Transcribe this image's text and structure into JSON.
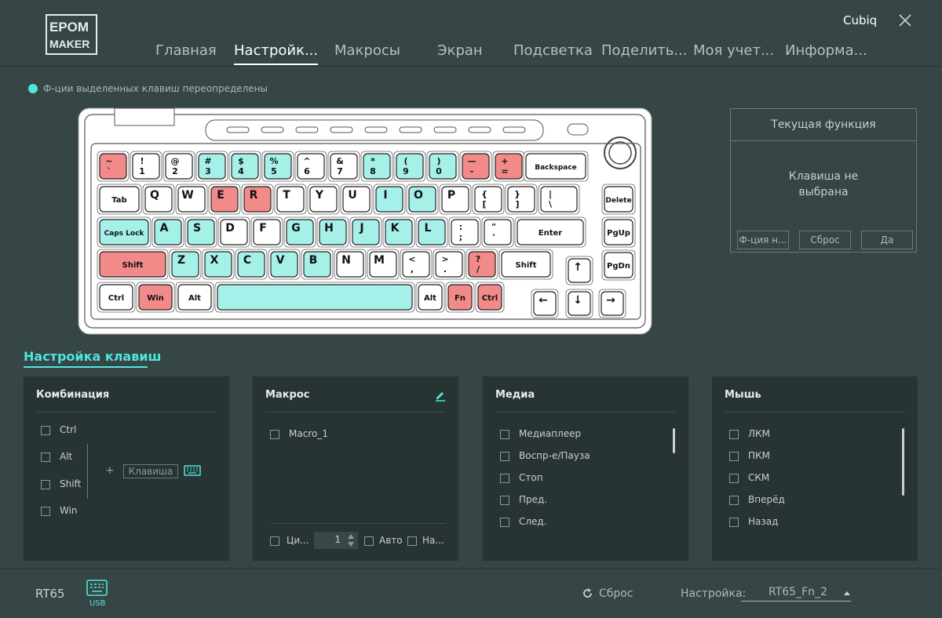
{
  "app": {
    "user": "Cubiq",
    "logo_text": [
      "EPOM",
      "MAKER"
    ]
  },
  "nav": [
    {
      "label": "Главная",
      "active": false
    },
    {
      "label": "Настройк...",
      "active": true
    },
    {
      "label": "Макросы",
      "active": false
    },
    {
      "label": "Экран",
      "active": false
    },
    {
      "label": "Подсветка",
      "active": false
    },
    {
      "label": "Поделить...",
      "active": false
    },
    {
      "label": "Моя учет...",
      "active": false
    },
    {
      "label": "Информа...",
      "active": false
    }
  ],
  "hint": "Ф-ции выделенных клавиш переопределены",
  "colors": {
    "accent": "#4fe6dc",
    "key_red": "#f28a8a",
    "key_cyan": "#a6f0ea",
    "key_white": "#ffffff"
  },
  "keyboard": {
    "rows": [
      [
        {
          "t": "~",
          "b": "`",
          "c": "r"
        },
        {
          "t": "!",
          "b": "1"
        },
        {
          "t": "@",
          "b": "2"
        },
        {
          "t": "#",
          "b": "3",
          "c": "c"
        },
        {
          "t": "$",
          "b": "4",
          "c": "c"
        },
        {
          "t": "%",
          "b": "5",
          "c": "c"
        },
        {
          "t": "^",
          "b": "6"
        },
        {
          "t": "&",
          "b": "7"
        },
        {
          "t": "*",
          "b": "8",
          "c": "c"
        },
        {
          "t": "(",
          "b": "9",
          "c": "c"
        },
        {
          "t": ")",
          "b": "0",
          "c": "c"
        },
        {
          "t": "—",
          "b": "-",
          "c": "r"
        },
        {
          "t": "+",
          "b": "=",
          "c": "r"
        }
      ],
      [
        {
          "l": "Tab"
        },
        {
          "l": "Q"
        },
        {
          "l": "W"
        },
        {
          "l": "E",
          "c": "r"
        },
        {
          "l": "R",
          "c": "r"
        },
        {
          "l": "T"
        },
        {
          "l": "Y"
        },
        {
          "l": "U"
        },
        {
          "l": "I",
          "c": "c"
        },
        {
          "l": "O",
          "c": "c"
        },
        {
          "l": "P"
        },
        {
          "t": "{",
          "b": "["
        },
        {
          "t": "}",
          "b": "]"
        },
        {
          "t": "|",
          "b": "\\"
        }
      ],
      [
        {
          "l": "Caps Lock",
          "c": "c"
        },
        {
          "l": "A",
          "c": "c"
        },
        {
          "l": "S",
          "c": "c"
        },
        {
          "l": "D"
        },
        {
          "l": "F"
        },
        {
          "l": "G",
          "c": "c"
        },
        {
          "l": "H",
          "c": "c"
        },
        {
          "l": "J",
          "c": "c"
        },
        {
          "l": "K",
          "c": "c"
        },
        {
          "l": "L",
          "c": "c"
        },
        {
          "t": ":",
          "b": ";"
        },
        {
          "t": "\"",
          "b": "'"
        },
        {
          "l": "Enter"
        }
      ],
      [
        {
          "l": "Shift",
          "c": "r"
        },
        {
          "l": "Z",
          "c": "c"
        },
        {
          "l": "X",
          "c": "c"
        },
        {
          "l": "C",
          "c": "c"
        },
        {
          "l": "V",
          "c": "c"
        },
        {
          "l": "B",
          "c": "c"
        },
        {
          "l": "N"
        },
        {
          "l": "M"
        },
        {
          "t": "<",
          "b": ","
        },
        {
          "t": ">",
          "b": "."
        },
        {
          "t": "?",
          "b": "/",
          "c": "r"
        },
        {
          "l": "Shift"
        }
      ],
      [
        {
          "l": "Ctrl"
        },
        {
          "l": "Win",
          "c": "r"
        },
        {
          "l": "Alt"
        },
        {
          "l": "",
          "c": "c"
        },
        {
          "l": "Alt"
        },
        {
          "l": "Fn",
          "c": "r"
        },
        {
          "l": "Ctrl",
          "c": "r"
        }
      ]
    ],
    "backspace": "Backspace",
    "side": [
      "Delete",
      "PgUp",
      "PgDn"
    ],
    "arrows": [
      "↑",
      "←",
      "↓",
      "→"
    ]
  },
  "current_function": {
    "title": "Текущая функция",
    "message": "Клавиша не выбрана",
    "buttons": [
      "Ф-ция н...",
      "Сброс",
      "Да"
    ]
  },
  "section_title": "Настройка клавиш",
  "combo": {
    "title": "Комбинация",
    "mods": [
      "Ctrl",
      "Alt",
      "Shift",
      "Win"
    ],
    "plus": "+",
    "key_placeholder": "Клавиша"
  },
  "macro": {
    "title": "Макрос",
    "items": [
      "Macro_1"
    ],
    "cycle_label": "Ци...",
    "count": "1",
    "auto_label": "Авто",
    "on_label": "На..."
  },
  "media": {
    "title": "Медиа",
    "items": [
      "Медиаплеер",
      "Воспр-е/Пауза",
      "Стоп",
      "Пред.",
      "След."
    ]
  },
  "mouse": {
    "title": "Мышь",
    "items": [
      "ЛКМ",
      "ПКМ",
      "СКМ",
      "Вперёд",
      "Назад"
    ]
  },
  "footer": {
    "model": "RT65",
    "conn": "USB",
    "reset": "Сброс",
    "config_label": "Настройка:",
    "config_value": "RT65_Fn_2"
  }
}
